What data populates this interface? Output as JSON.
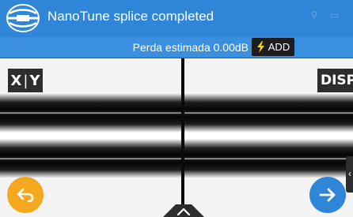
{
  "header": {
    "title": "NanoTune splice completed",
    "logo_icon": "splicer-logo-icon"
  },
  "loss_bar": {
    "loss_text": "Perda estimada  0.00dB",
    "add_label": "ADD",
    "add_icon": "lightning-icon"
  },
  "viewer": {
    "xy_button": {
      "left": "X",
      "right": "Y"
    },
    "disp_label": "DISP",
    "side_tab_icon": "chevron-left-icon"
  },
  "navigation": {
    "back_icon": "back-arrow-icon",
    "next_icon": "next-arrow-icon",
    "center_tab_icon": "chevron-up-icon"
  },
  "colors": {
    "header_blue": "#2f86d8",
    "bar_blue": "#3a90df",
    "back_orange": "#f5a720",
    "bolt_yellow": "#ffd21a"
  }
}
